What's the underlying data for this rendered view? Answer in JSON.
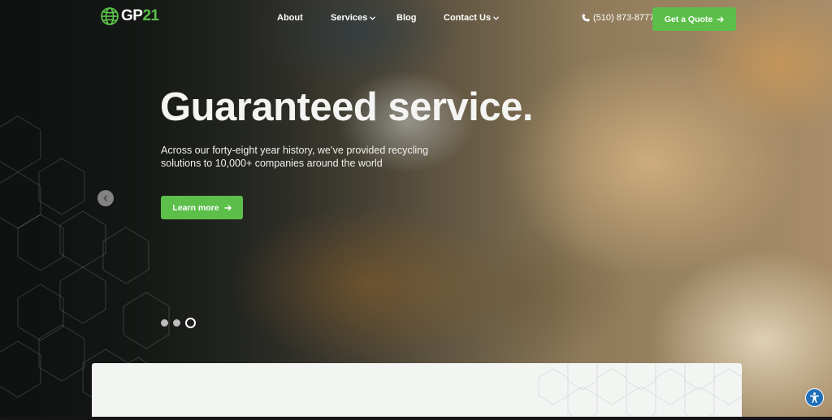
{
  "brand": {
    "name_part1": "GP",
    "name_part2": "21",
    "accent_color": "#5cbf4a"
  },
  "nav": {
    "items": [
      {
        "label": "About",
        "has_dropdown": false
      },
      {
        "label": "Services",
        "has_dropdown": true
      },
      {
        "label": "Blog",
        "has_dropdown": false
      },
      {
        "label": "Contact Us",
        "has_dropdown": true
      }
    ],
    "phone": "(510) 873-8777",
    "phone_icon": "phone-icon",
    "cta_label": "Get a Quote",
    "cta_icon": "arrow-right-icon"
  },
  "hero": {
    "headline": "Guaranteed service.",
    "subtext": "Across our forty-eight year history, we’ve provided recycling solutions to 10,000+ companies around the world",
    "button_label": "Learn more",
    "button_icon": "arrow-right-icon",
    "prev_icon": "chevron-left-icon",
    "slides_total": 3,
    "active_slide": 3
  },
  "accessibility": {
    "icon": "accessibility-icon"
  }
}
